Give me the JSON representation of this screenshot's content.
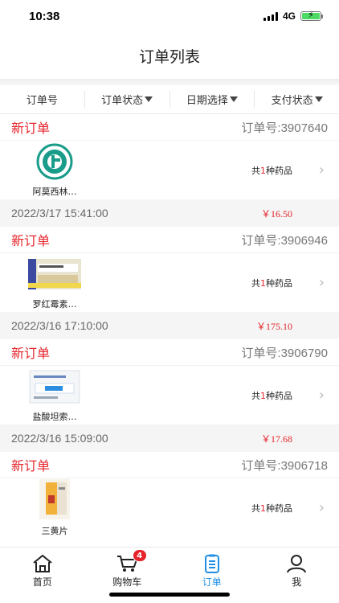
{
  "status_bar": {
    "time": "10:38",
    "network": "4G"
  },
  "header": {
    "title": "订单列表"
  },
  "filters": [
    {
      "label": "订单号",
      "dropdown": false
    },
    {
      "label": "订单状态",
      "dropdown": true
    },
    {
      "label": "日期选择",
      "dropdown": true
    },
    {
      "label": "支付状态",
      "dropdown": true
    }
  ],
  "orders": [
    {
      "status": "新订单",
      "order_no": "订单号:3907640",
      "item_name": "阿莫西林…",
      "item_count_prefix": "共",
      "item_count": "1",
      "item_count_suffix": "种药品",
      "time": "2022/3/17 15:41:00",
      "price": "￥16.50"
    },
    {
      "status": "新订单",
      "order_no": "订单号:3906946",
      "item_name": "罗红霉素…",
      "item_count_prefix": "共",
      "item_count": "1",
      "item_count_suffix": "种药品",
      "time": "2022/3/16 17:10:00",
      "price": "￥175.10"
    },
    {
      "status": "新订单",
      "order_no": "订单号:3906790",
      "item_name": "盐酸坦索…",
      "item_count_prefix": "共",
      "item_count": "1",
      "item_count_suffix": "种药品",
      "time": "2022/3/16 15:09:00",
      "price": "￥17.68"
    },
    {
      "status": "新订单",
      "order_no": "订单号:3906718",
      "item_name": "三黄片",
      "item_count_prefix": "共",
      "item_count": "1",
      "item_count_suffix": "种药品"
    }
  ],
  "tab_bar": {
    "items": [
      {
        "label": "首页",
        "icon": "home-icon"
      },
      {
        "label": "购物车",
        "icon": "cart-icon",
        "badge": "4"
      },
      {
        "label": "订单",
        "icon": "order-list-icon",
        "active": true
      },
      {
        "label": "我",
        "icon": "person-icon"
      }
    ]
  },
  "colors": {
    "accent_red": "#e5242b",
    "active_blue": "#1f8fe6"
  }
}
